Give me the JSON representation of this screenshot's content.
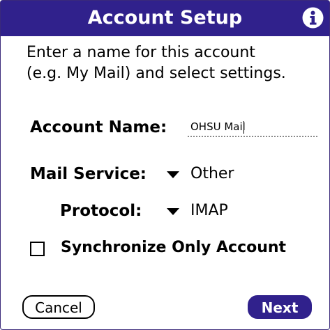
{
  "window": {
    "title": "Account Setup",
    "title_bar_color": "#30218c",
    "icon": "info-icon"
  },
  "intro_text": {
    "line1": "Enter a name for this account",
    "line2": "(e.g. My Mail) and select settings."
  },
  "account_name": {
    "label": "Account Name:",
    "value": "OHSU Mail"
  },
  "mail_service": {
    "label": "Mail Service:",
    "selected": "Other",
    "icon": "dropdown-triangle-icon"
  },
  "protocol": {
    "label": "Protocol:",
    "selected": "IMAP",
    "icon": "dropdown-triangle-icon"
  },
  "sync_only": {
    "label": "Synchronize Only Account",
    "checked": false
  },
  "buttons": {
    "cancel": "Cancel",
    "next": "Next",
    "next_color": "#30218c"
  }
}
